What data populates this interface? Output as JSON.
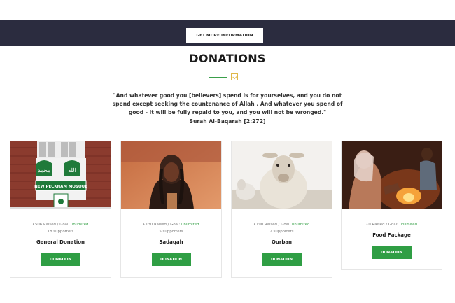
{
  "banner": {
    "button_label": "GET MORE INFORMATION"
  },
  "section": {
    "title": "DONATIONS",
    "quote": "\"And whatever good you [believers] spend is for yourselves, and you do not spend except seeking the countenance of Allah . And whatever you spend of good - it will be fully repaid to you, and you will not be wronged.\"",
    "source": "Surah Al-Baqarah [2:272]"
  },
  "cards": [
    {
      "raised": "£506 Raised / Goal:",
      "goal": "unlimited",
      "supporters": "18 supporters",
      "name": "General Donation",
      "button": "DONATION",
      "image_sign": "NEW PECKHAM MOSQUE"
    },
    {
      "raised": "£130 Raised / Goal:",
      "goal": "unlimited",
      "supporters": "5 supporters",
      "name": "Sadaqah",
      "button": "DONATION"
    },
    {
      "raised": "£190 Raised / Goal:",
      "goal": "unlimited",
      "supporters": "2 supporters",
      "name": "Qurban",
      "button": "DONATION"
    },
    {
      "raised": "£0 Raised / Goal:",
      "goal": "unlimited",
      "supporters": "",
      "name": "Food Package",
      "button": "DONATION"
    }
  ],
  "colors": {
    "banner": "#2b2c3f",
    "accent": "#2f9e44",
    "gold": "#e0b84a"
  }
}
